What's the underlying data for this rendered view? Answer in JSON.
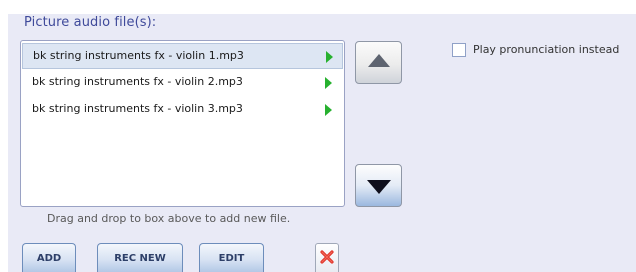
{
  "group": {
    "title": "Picture audio file(s):"
  },
  "audio_list": {
    "items": [
      {
        "label": "bk string instruments fx - violin 1.mp3",
        "selected": true,
        "icon": "play-icon"
      },
      {
        "label": "bk string instruments fx - violin 2.mp3",
        "selected": false,
        "icon": "play-icon"
      },
      {
        "label": "bk string instruments fx - violin 3.mp3",
        "selected": false,
        "icon": "play-icon"
      }
    ]
  },
  "reorder": {
    "up_icon": "triangle-up-icon",
    "down_icon": "triangle-down-icon"
  },
  "options": {
    "play_pronunciation_label": "Play pronunciation instead",
    "play_pronunciation_checked": false
  },
  "hint": "Drag and drop to box above to add new file.",
  "buttons": {
    "add_label": "ADD",
    "rec_new_label": "REC NEW",
    "edit_label": "EDIT",
    "delete_icon": "red-x-icon"
  },
  "colors": {
    "panel_background": "#e9eaf6",
    "title_color": "#3f4a9a",
    "play_icon": "#27b12f",
    "delete_icon": "#e0362b"
  }
}
